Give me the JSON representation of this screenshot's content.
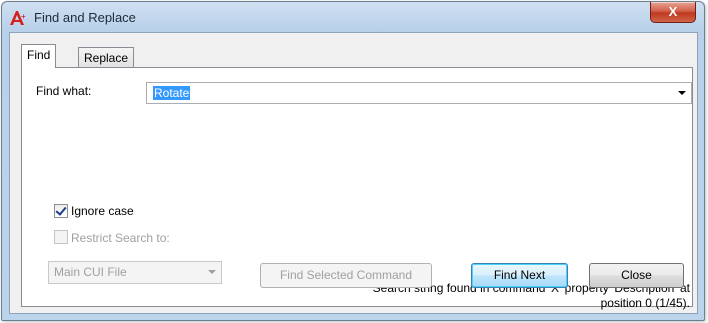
{
  "window": {
    "title": "Find and Replace",
    "close_label": "X"
  },
  "tabs": [
    {
      "label": "Find",
      "active": true
    },
    {
      "label": "Replace",
      "active": false
    }
  ],
  "find": {
    "find_what_label": "Find what:",
    "find_what_value": "Rotate"
  },
  "options": {
    "ignore_case_label": "Ignore case",
    "ignore_case_checked": true,
    "restrict_search_label": "Restrict Search to:",
    "restrict_search_checked": false,
    "restrict_scope_value": "Main CUI File"
  },
  "status": {
    "line1": "Search string found in command 'X' property 'Description' at",
    "line2": "position 0 (1/45)."
  },
  "buttons": {
    "find_selected_command": "Find Selected Command",
    "find_next": "Find Next",
    "close": "Close"
  },
  "colors": {
    "selection": "#3399ff",
    "title_close": "#c0391f"
  }
}
